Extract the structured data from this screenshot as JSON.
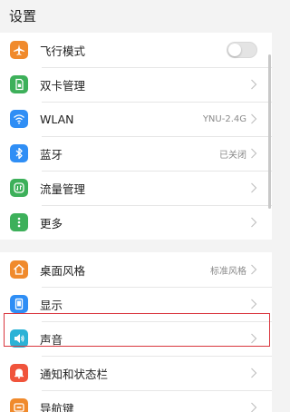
{
  "header": {
    "title": "设置"
  },
  "groups": [
    [
      {
        "label": "飞行模式",
        "icon": "airplane-icon",
        "color": "#f08a2c",
        "control": "toggle",
        "toggle_on": false
      },
      {
        "label": "双卡管理",
        "icon": "sim-card-icon",
        "color": "#3db05a",
        "control": "chevron"
      },
      {
        "label": "WLAN",
        "icon": "wifi-icon",
        "color": "#2f8ef5",
        "value": "YNU-2.4G",
        "control": "chevron"
      },
      {
        "label": "蓝牙",
        "icon": "bluetooth-icon",
        "color": "#2f8ef5",
        "value": "已关闭",
        "control": "chevron"
      },
      {
        "label": "流量管理",
        "icon": "data-usage-icon",
        "color": "#3db05a",
        "control": "chevron"
      },
      {
        "label": "更多",
        "icon": "more-icon",
        "color": "#3db05a",
        "control": "chevron"
      }
    ],
    [
      {
        "label": "桌面风格",
        "icon": "home-icon",
        "color": "#f08a2c",
        "value": "标准风格",
        "control": "chevron"
      },
      {
        "label": "显示",
        "icon": "display-icon",
        "color": "#2f8ef5",
        "control": "chevron"
      },
      {
        "label": "声音",
        "icon": "speaker-icon",
        "color": "#2bb2d6",
        "control": "chevron",
        "highlighted": true
      },
      {
        "label": "通知和状态栏",
        "icon": "bell-icon",
        "color": "#f0543c",
        "control": "chevron"
      },
      {
        "label": "导航键",
        "icon": "navigation-key-icon",
        "color": "#f08a2c",
        "control": "chevron"
      }
    ]
  ],
  "colors": {
    "highlight_border": "#d9363e",
    "background": "#f3f3f3"
  }
}
